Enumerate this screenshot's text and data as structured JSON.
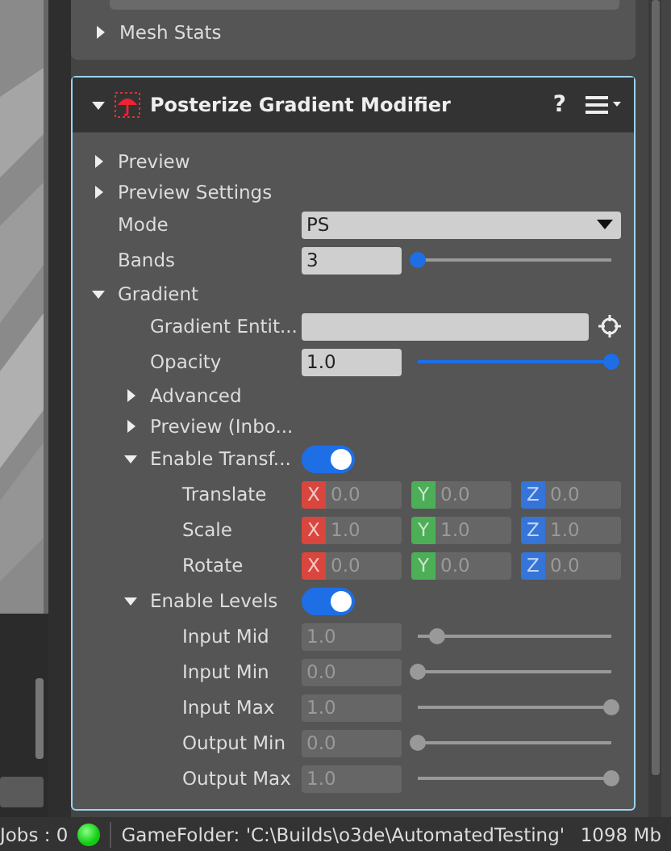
{
  "top_section": {
    "add_button": {
      "kind": "button"
    },
    "items": [
      {
        "label": "Mesh Stats",
        "expanded": false
      }
    ]
  },
  "component": {
    "title": "Posterize Gradient Modifier",
    "expanded": true,
    "selected": true,
    "help": "?",
    "properties": [
      {
        "kind": "group",
        "label": "Preview",
        "expanded": false
      },
      {
        "kind": "group",
        "label": "Preview Settings",
        "expanded": false
      },
      {
        "kind": "combo",
        "label": "Mode",
        "value": "PS"
      },
      {
        "kind": "slider",
        "label": "Bands",
        "value": "3",
        "level": 0,
        "disabled": false
      },
      {
        "kind": "group",
        "label": "Gradient",
        "expanded": true,
        "children": [
          {
            "kind": "entity",
            "label": "Gradient Entit..."
          },
          {
            "kind": "slider",
            "label": "Opacity",
            "value": "1.0",
            "level": 1,
            "disabled": false
          },
          {
            "kind": "group",
            "label": "Advanced",
            "expanded": false
          },
          {
            "kind": "group",
            "label": "Preview (Inbo...",
            "expanded": false
          },
          {
            "kind": "toggle",
            "label": "Enable Transf...",
            "expanded": true,
            "on": true,
            "children": [
              {
                "kind": "vector",
                "label": "Translate",
                "disabled": true,
                "fields": [
                  {
                    "axis": "X",
                    "value": "0.0"
                  },
                  {
                    "axis": "Y",
                    "value": "0.0"
                  },
                  {
                    "axis": "Z",
                    "value": "0.0"
                  }
                ]
              },
              {
                "kind": "vector",
                "label": "Scale",
                "disabled": true,
                "fields": [
                  {
                    "axis": "X",
                    "value": "1.0"
                  },
                  {
                    "axis": "Y",
                    "value": "1.0"
                  },
                  {
                    "axis": "Z",
                    "value": "1.0"
                  }
                ]
              },
              {
                "kind": "vector",
                "label": "Rotate",
                "disabled": true,
                "fields": [
                  {
                    "axis": "X",
                    "value": "0.0"
                  },
                  {
                    "axis": "Y",
                    "value": "0.0"
                  },
                  {
                    "axis": "Z",
                    "value": "0.0"
                  }
                ]
              }
            ]
          },
          {
            "kind": "toggle",
            "label": "Enable Levels",
            "expanded": true,
            "on": true,
            "children": [
              {
                "kind": "slider",
                "label": "Input Mid",
                "value": "1.0",
                "level": 0.1,
                "disabled": true
              },
              {
                "kind": "slider",
                "label": "Input Min",
                "value": "0.0",
                "level": 0,
                "disabled": true
              },
              {
                "kind": "slider",
                "label": "Input Max",
                "value": "1.0",
                "level": 1,
                "disabled": true
              },
              {
                "kind": "slider",
                "label": "Output Min",
                "value": "0.0",
                "level": 0,
                "disabled": true
              },
              {
                "kind": "slider",
                "label": "Output Max",
                "value": "1.0",
                "level": 1,
                "disabled": true
              }
            ]
          }
        ]
      }
    ]
  },
  "status_bar": {
    "jobs": "Jobs : 0",
    "ok": true,
    "game_folder": "GameFolder: 'C:\\Builds\\o3de\\AutomatedTesting'",
    "memory": "1098 Mb"
  }
}
